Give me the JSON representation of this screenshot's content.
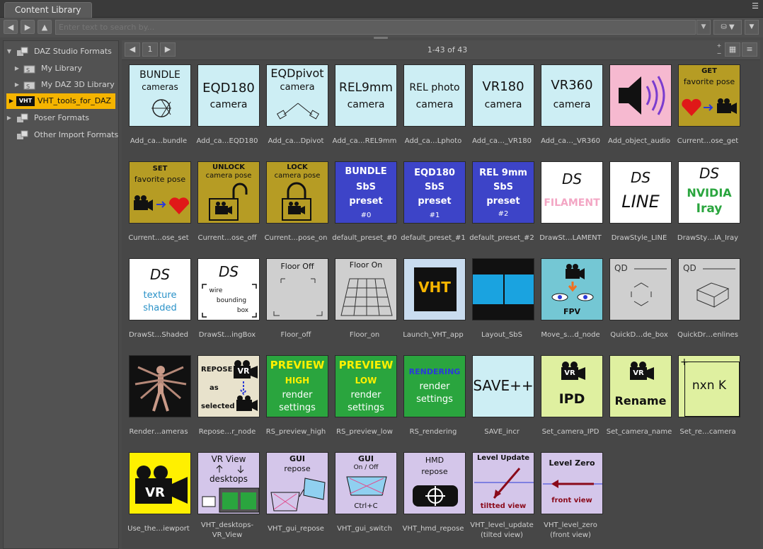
{
  "panel": {
    "tab_title": "Content Library",
    "menu_icon": "panel-menu-icon"
  },
  "toolbar": {
    "back": "◀",
    "forward": "▶",
    "up": "▲",
    "search_placeholder": "Enter text to search by...",
    "search_dropdown": "▼",
    "db_label": "▼",
    "extra": "▼"
  },
  "tree": {
    "items": [
      {
        "label": "DAZ Studio Formats",
        "arrow": "▼"
      },
      {
        "label": "My Library",
        "arrow": "▶"
      },
      {
        "label": "My DAZ 3D Library",
        "arrow": "▶"
      },
      {
        "label": "VHT_tools_for_DAZ",
        "arrow": "▶",
        "icon_text": "VHT",
        "selected": true
      },
      {
        "label": "Poser Formats",
        "arrow": "▶"
      },
      {
        "label": "Other Import Formats",
        "arrow": ""
      }
    ],
    "selected_color": "#f5b400"
  },
  "content": {
    "page": "1",
    "count": "1-43 of 43",
    "prev": "◀",
    "next": "▶"
  },
  "tiles": [
    {
      "name": "Add_ca…bundle",
      "lines": [
        "BUNDLE",
        "cameras"
      ]
    },
    {
      "name": "Add_ca…EQD180",
      "lines": [
        "EQD180",
        "camera"
      ]
    },
    {
      "name": "Add_ca…Dpivot",
      "lines": [
        "EQDpivot",
        "camera"
      ]
    },
    {
      "name": "Add_ca…REL9mm",
      "lines": [
        "REL9mm",
        "camera"
      ]
    },
    {
      "name": "Add_ca…Lphoto",
      "lines": [
        "REL photo",
        "camera"
      ]
    },
    {
      "name": "Add_ca…_VR180",
      "lines": [
        "VR180",
        "camera"
      ]
    },
    {
      "name": "Add_ca…_VR360",
      "lines": [
        "VR360",
        "camera"
      ]
    },
    {
      "name": "Add_object_audio",
      "lines": []
    },
    {
      "name": "Current…ose_get",
      "lines": [
        "GET",
        "favorite pose"
      ]
    },
    {
      "name": "Current…ose_set",
      "lines": [
        "SET",
        "favorite pose"
      ]
    },
    {
      "name": "Current…ose_off",
      "lines": [
        "UNLOCK",
        "camera pose"
      ]
    },
    {
      "name": "Current…pose_on",
      "lines": [
        "LOCK",
        "camera pose"
      ]
    },
    {
      "name": "default_preset_#0",
      "lines": [
        "BUNDLE",
        "SbS",
        "preset",
        "#0"
      ]
    },
    {
      "name": "default_preset_#1",
      "lines": [
        "EQD180",
        "SbS",
        "preset",
        "#1"
      ]
    },
    {
      "name": "default_preset_#2",
      "lines": [
        "REL 9mm",
        "SbS",
        "preset",
        "#2"
      ]
    },
    {
      "name": "DrawSt…LAMENT",
      "lines": [
        "DS",
        "FILAMENT"
      ]
    },
    {
      "name": "DrawStyle_LINE",
      "lines": [
        "DS",
        "LINE"
      ]
    },
    {
      "name": "DrawSty…IA_Iray",
      "lines": [
        "DS",
        "NVIDIA",
        "Iray"
      ]
    },
    {
      "name": "DrawSt…Shaded",
      "lines": [
        "DS",
        "texture",
        "shaded"
      ]
    },
    {
      "name": "DrawSt…ingBox",
      "lines": [
        "DS",
        "wire",
        "bounding",
        "box"
      ]
    },
    {
      "name": "Floor_off",
      "lines": [
        "Floor Off"
      ]
    },
    {
      "name": "Floor_on",
      "lines": [
        "Floor On"
      ]
    },
    {
      "name": "Launch_VHT_app",
      "lines": [
        "VHT"
      ]
    },
    {
      "name": "Layout_SbS",
      "lines": []
    },
    {
      "name": "Move_s…d_node",
      "lines": [
        "FPV"
      ]
    },
    {
      "name": "QuickD…de_box",
      "lines": [
        "QD"
      ]
    },
    {
      "name": "QuickDr…enlines",
      "lines": [
        "QD"
      ]
    },
    {
      "name": "Render…ameras",
      "lines": []
    },
    {
      "name": "Repose…r_node",
      "lines": [
        "REPOSE",
        "as",
        "selected",
        "VR"
      ]
    },
    {
      "name": "RS_preview_high",
      "lines": [
        "PREVIEW",
        "HIGH",
        "render",
        "settings"
      ]
    },
    {
      "name": "RS_preview_low",
      "lines": [
        "PREVIEW",
        "LOW",
        "render",
        "settings"
      ]
    },
    {
      "name": "RS_rendering",
      "lines": [
        "RENDERING",
        "render",
        "settings"
      ]
    },
    {
      "name": "SAVE_incr",
      "lines": [
        "SAVE++"
      ]
    },
    {
      "name": "Set_camera_IPD",
      "lines": [
        "IPD",
        "VR"
      ]
    },
    {
      "name": "Set_camera_name",
      "lines": [
        "Rename",
        "VR"
      ]
    },
    {
      "name": "Set_re…camera",
      "lines": [
        "nxn K"
      ]
    },
    {
      "name": "Use_the…iewport",
      "lines": [
        "VR"
      ]
    },
    {
      "name": "VHT_desktops-\nVR_View",
      "lines": [
        "VR View",
        "desktops"
      ]
    },
    {
      "name": "VHT_gui_repose",
      "lines": [
        "GUI",
        "repose"
      ]
    },
    {
      "name": "VHT_gui_switch",
      "lines": [
        "GUI",
        "On / Off",
        "Ctrl+C"
      ]
    },
    {
      "name": "VHT_hmd_repose",
      "lines": [
        "HMD",
        "repose"
      ]
    },
    {
      "name": "VHT_level_update\n(tilted view)",
      "lines": [
        "Level Update",
        "tiltted view"
      ]
    },
    {
      "name": "VHT_level_zero\n(front view)",
      "lines": [
        "Level Zero",
        "front view"
      ]
    }
  ]
}
